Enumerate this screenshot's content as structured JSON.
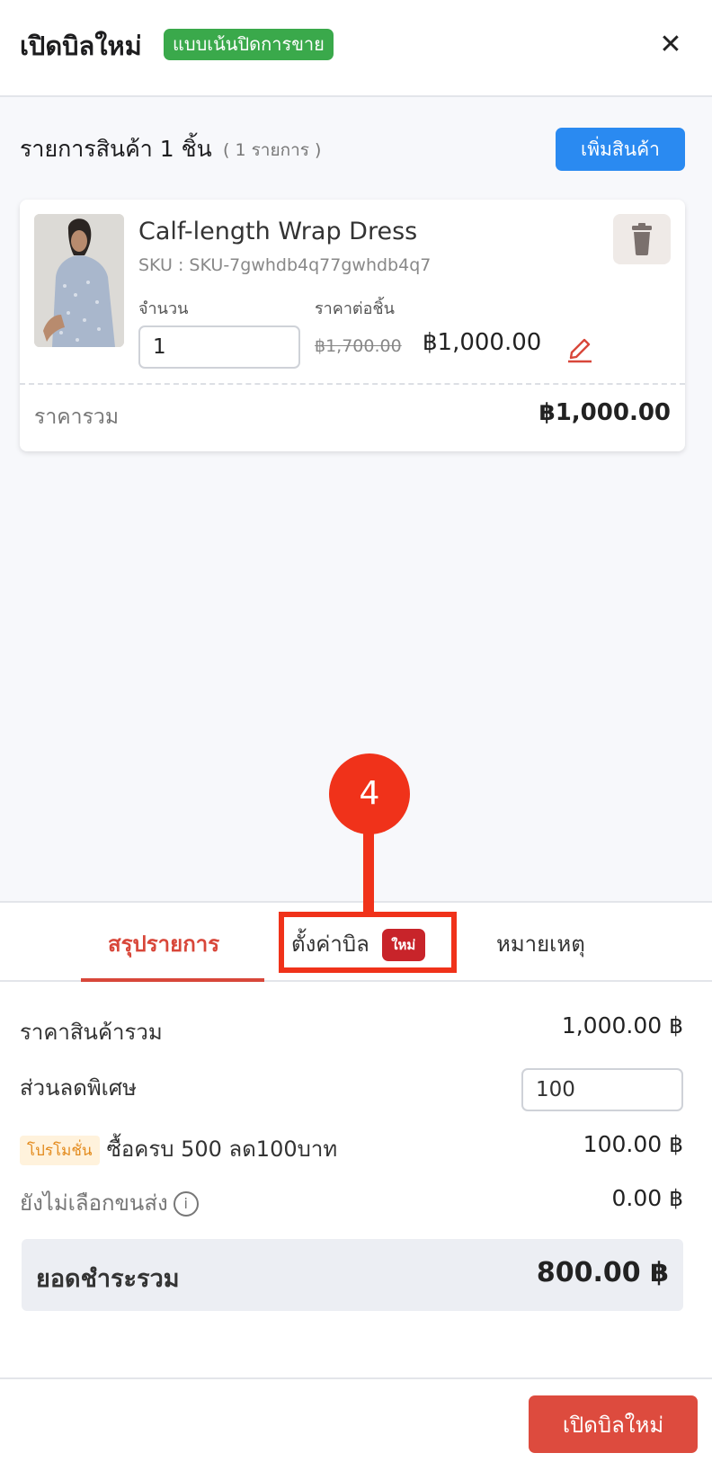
{
  "header": {
    "title": "เปิดบิลใหม่",
    "mode_badge": "แบบเน้นปิดการขาย",
    "close_glyph": "✕"
  },
  "items_section": {
    "title": "รายการสินค้า 1 ชิ้น",
    "count": "( 1 รายการ )",
    "add_button": "เพิ่มสินค้า"
  },
  "item": {
    "name": "Calf-length Wrap Dress",
    "sku": "SKU : SKU-7gwhdb4q77gwhdb4q7",
    "qty_label": "จำนวน",
    "qty_value": "1",
    "price_label": "ราคาต่อชิ้น",
    "old_price": "฿1,700.00",
    "new_price": "฿1,000.00",
    "total_label": "ราคารวม",
    "total_value": "฿1,000.00"
  },
  "annotation": {
    "step": "4"
  },
  "tabs": [
    {
      "label": "สรุปรายการ"
    },
    {
      "label": "ตั้งค่าบิล",
      "badge": "ใหม่"
    },
    {
      "label": "หมายเหตุ"
    }
  ],
  "summary": {
    "subtotal_label": "ราคาสินค้ารวม",
    "subtotal_value": "1,000.00 ฿",
    "special_discount_label": "ส่วนลดพิเศษ",
    "special_discount_value": "100",
    "promo_badge": "โปรโมชั่น",
    "promo_label": "ซื้อครบ 500 ลด100บาท",
    "promo_value": "100.00 ฿",
    "shipping_label": "ยังไม่เลือกขนส่ง",
    "shipping_value": "0.00 ฿",
    "grand_total_label": "ยอดชำระรวม",
    "grand_total_value": "800.00 ฿"
  },
  "footer": {
    "submit_button": "เปิดบิลใหม่"
  },
  "colors": {
    "accent_red": "#dd4b3e",
    "primary_blue": "#2a8af1",
    "badge_green": "#3aa94b",
    "annotation_red": "#f0321a"
  }
}
